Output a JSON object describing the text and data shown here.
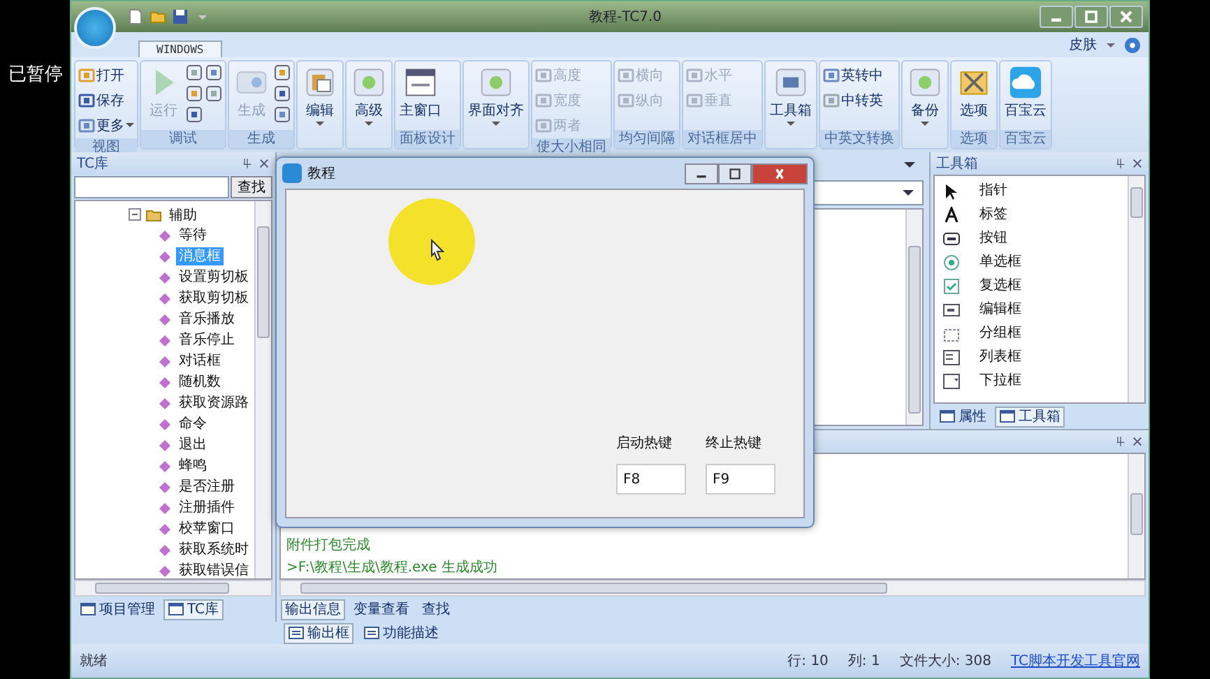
{
  "player_overlay": {
    "text": "已暂停"
  },
  "window": {
    "title": "教程-TC7.0"
  },
  "ribbon": {
    "tabs": [
      {
        "label": "WINDOWS",
        "selected": true
      }
    ],
    "skin_menu": "皮肤",
    "groups": [
      {
        "label": "视图",
        "items": [
          {
            "kind": "small",
            "label": "打开",
            "disabled": false
          },
          {
            "kind": "small",
            "label": "保存",
            "disabled": false
          },
          {
            "kind": "small",
            "label": "更多",
            "disabled": false,
            "dropdown": true
          }
        ]
      },
      {
        "label": "调试",
        "items": [
          {
            "kind": "large",
            "label": "运行",
            "disabled": true
          },
          {
            "kind": "icon",
            "disabled": false
          },
          {
            "kind": "icon",
            "disabled": false
          },
          {
            "kind": "icon",
            "disabled": false
          },
          {
            "kind": "icon",
            "disabled": false
          },
          {
            "kind": "icon",
            "disabled": false
          }
        ]
      },
      {
        "label": "生成",
        "items": [
          {
            "kind": "large",
            "label": "生成",
            "disabled": true
          },
          {
            "kind": "icon",
            "disabled": false
          },
          {
            "kind": "icon",
            "disabled": false
          },
          {
            "kind": "icon",
            "disabled": false
          }
        ]
      },
      {
        "items": [
          {
            "kind": "large",
            "label": "编辑",
            "disabled": false,
            "dropdown": true
          }
        ]
      },
      {
        "items": [
          {
            "kind": "large",
            "label": "高级",
            "disabled": false,
            "dropdown": true
          }
        ]
      },
      {
        "label": "面板设计",
        "items": [
          {
            "kind": "large",
            "label": "主窗口",
            "disabled": false
          }
        ]
      },
      {
        "items": [
          {
            "kind": "large",
            "label": "界面对齐",
            "disabled": false,
            "dropdown": true
          }
        ]
      },
      {
        "label": "使大小相同",
        "items": [
          {
            "kind": "small",
            "label": "高度",
            "disabled": true
          },
          {
            "kind": "small",
            "label": "宽度",
            "disabled": true
          },
          {
            "kind": "small",
            "label": "两者",
            "disabled": true
          }
        ]
      },
      {
        "label": "均匀间隔",
        "items": [
          {
            "kind": "small",
            "label": "横向",
            "disabled": true
          },
          {
            "kind": "small",
            "label": "纵向",
            "disabled": true
          }
        ]
      },
      {
        "label": "对话框居中",
        "items": [
          {
            "kind": "small",
            "label": "水平",
            "disabled": true
          },
          {
            "kind": "small",
            "label": "垂直",
            "disabled": true
          }
        ]
      },
      {
        "items": [
          {
            "kind": "large",
            "label": "工具箱",
            "disabled": false,
            "dropdown": true
          }
        ]
      },
      {
        "label": "中英文转换",
        "items": [
          {
            "kind": "small",
            "label": "英转中",
            "disabled": false
          },
          {
            "kind": "small",
            "label": "中转英",
            "disabled": false
          }
        ]
      },
      {
        "items": [
          {
            "kind": "large",
            "label": "备份",
            "disabled": false,
            "dropdown": true
          }
        ]
      },
      {
        "label": "选项",
        "items": [
          {
            "kind": "large",
            "label": "选项",
            "disabled": false
          }
        ]
      },
      {
        "label": "百宝云",
        "items": [
          {
            "kind": "large",
            "label": "百宝云",
            "disabled": false
          }
        ]
      }
    ]
  },
  "library_panel": {
    "title": "TC库",
    "search_button": "查找",
    "tree": [
      {
        "label": "辅助",
        "expanded": true,
        "children": [
          {
            "label": "等待",
            "selected": false
          },
          {
            "label": "消息框",
            "selected": true
          },
          {
            "label": "设置剪切板",
            "selected": false
          },
          {
            "label": "获取剪切板",
            "selected": false
          },
          {
            "label": "音乐播放",
            "selected": false
          },
          {
            "label": "音乐停止",
            "selected": false
          },
          {
            "label": "对话框",
            "selected": false
          },
          {
            "label": "随机数",
            "selected": false
          },
          {
            "label": "获取资源路",
            "selected": false
          },
          {
            "label": "命令",
            "selected": false
          },
          {
            "label": "退出",
            "selected": false
          },
          {
            "label": "蜂鸣",
            "selected": false
          },
          {
            "label": "是否注册",
            "selected": false
          },
          {
            "label": "注册插件",
            "selected": false
          },
          {
            "label": "校苹窗口",
            "selected": false
          },
          {
            "label": "获取系统时",
            "selected": false
          },
          {
            "label": "获取错误信",
            "selected": false
          }
        ]
      }
    ],
    "tabs": [
      {
        "label": "项目管理",
        "selected": false
      },
      {
        "label": "TC库",
        "selected": true
      }
    ]
  },
  "toolbox_panel": {
    "title": "工具箱",
    "items": [
      "指针",
      "标签",
      "按钮",
      "单选框",
      "复选框",
      "编辑框",
      "分组框",
      "列表框",
      "下拉框"
    ],
    "tabs": [
      {
        "label": "属性",
        "selected": false
      },
      {
        "label": "工具箱",
        "selected": true
      }
    ]
  },
  "output_panel": {
    "lines": [
      "附件打包完成",
      ">F:\\教程\\生成\\教程.exe 生成成功"
    ],
    "tabs": [
      {
        "label": "输出信息",
        "selected": true
      },
      {
        "label": "变量查看",
        "selected": false
      },
      {
        "label": "查找",
        "selected": false
      }
    ]
  },
  "bottom_tabs": [
    {
      "label": "输出框",
      "selected": true
    },
    {
      "label": "功能描述",
      "selected": false
    }
  ],
  "dialog": {
    "title": "教程",
    "fields": [
      {
        "label": "启动热键",
        "value": "F8"
      },
      {
        "label": "终止热键",
        "value": "F9"
      }
    ]
  },
  "status_bar": {
    "message": "就绪",
    "row": "行: 10",
    "col": "列: 1",
    "file_size": "文件大小: 308",
    "link": "TC脚本开发工具官网"
  }
}
